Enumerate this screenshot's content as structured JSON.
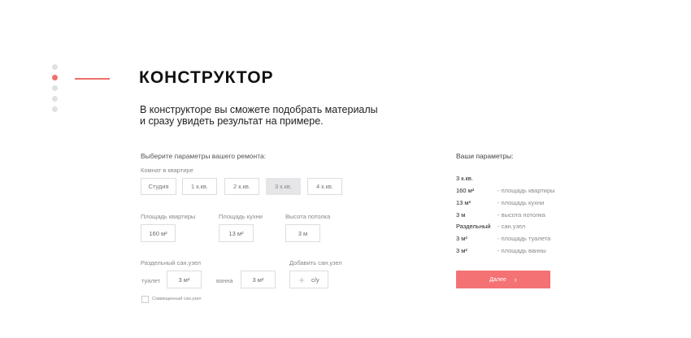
{
  "title": "КОНСТРУКТОР",
  "intro": {
    "line1": "В конструкторе вы сможете подобрать материалы",
    "line2": "и сразу увидеть результат на примере."
  },
  "form": {
    "heading": "Выберите параметры вашего ремонта:",
    "rooms_label": "Комнат в квартире",
    "rooms": [
      "Студия",
      "1 к.кв.",
      "2 к.кв.",
      "3 к.кв.",
      "4 к.кв."
    ],
    "rooms_selected": "3 к.кв.",
    "area_label": "Площадь квартиры",
    "area_value": "160 м²",
    "kitchen_label": "Площадь кухни",
    "kitchen_value": "13 м²",
    "ceiling_label": "Высота потолка",
    "ceiling_value": "3 м",
    "bath_label": "Раздельный сан.узел",
    "toilet_label": "туалет",
    "toilet_value": "3 м²",
    "bath_word": "ванна",
    "bath_value": "3 м²",
    "add_label": "Добавить сан.узел",
    "add_value": "с/у",
    "combined_label": "Совмещенный сан.узел"
  },
  "params": {
    "heading": "Ваши параметры:",
    "rows": [
      {
        "value": "3 к.кв.",
        "desc": ""
      },
      {
        "value": "160 м²",
        "desc": "- площадь квартиры"
      },
      {
        "value": "13 м²",
        "desc": "- площадь кухни"
      },
      {
        "value": "3 м",
        "desc": "- высота потолка"
      },
      {
        "value": "Раздельный",
        "desc": "- сан.узел"
      },
      {
        "value": "3 м²",
        "desc": "- площадь туалета"
      },
      {
        "value": "3 м²",
        "desc": "- площадь ванны"
      }
    ],
    "next_label": "Далее",
    "next_icon": "chevron-right-icon"
  },
  "colors": {
    "accent": "#f47274",
    "selected_bg": "#e6e6e8"
  }
}
